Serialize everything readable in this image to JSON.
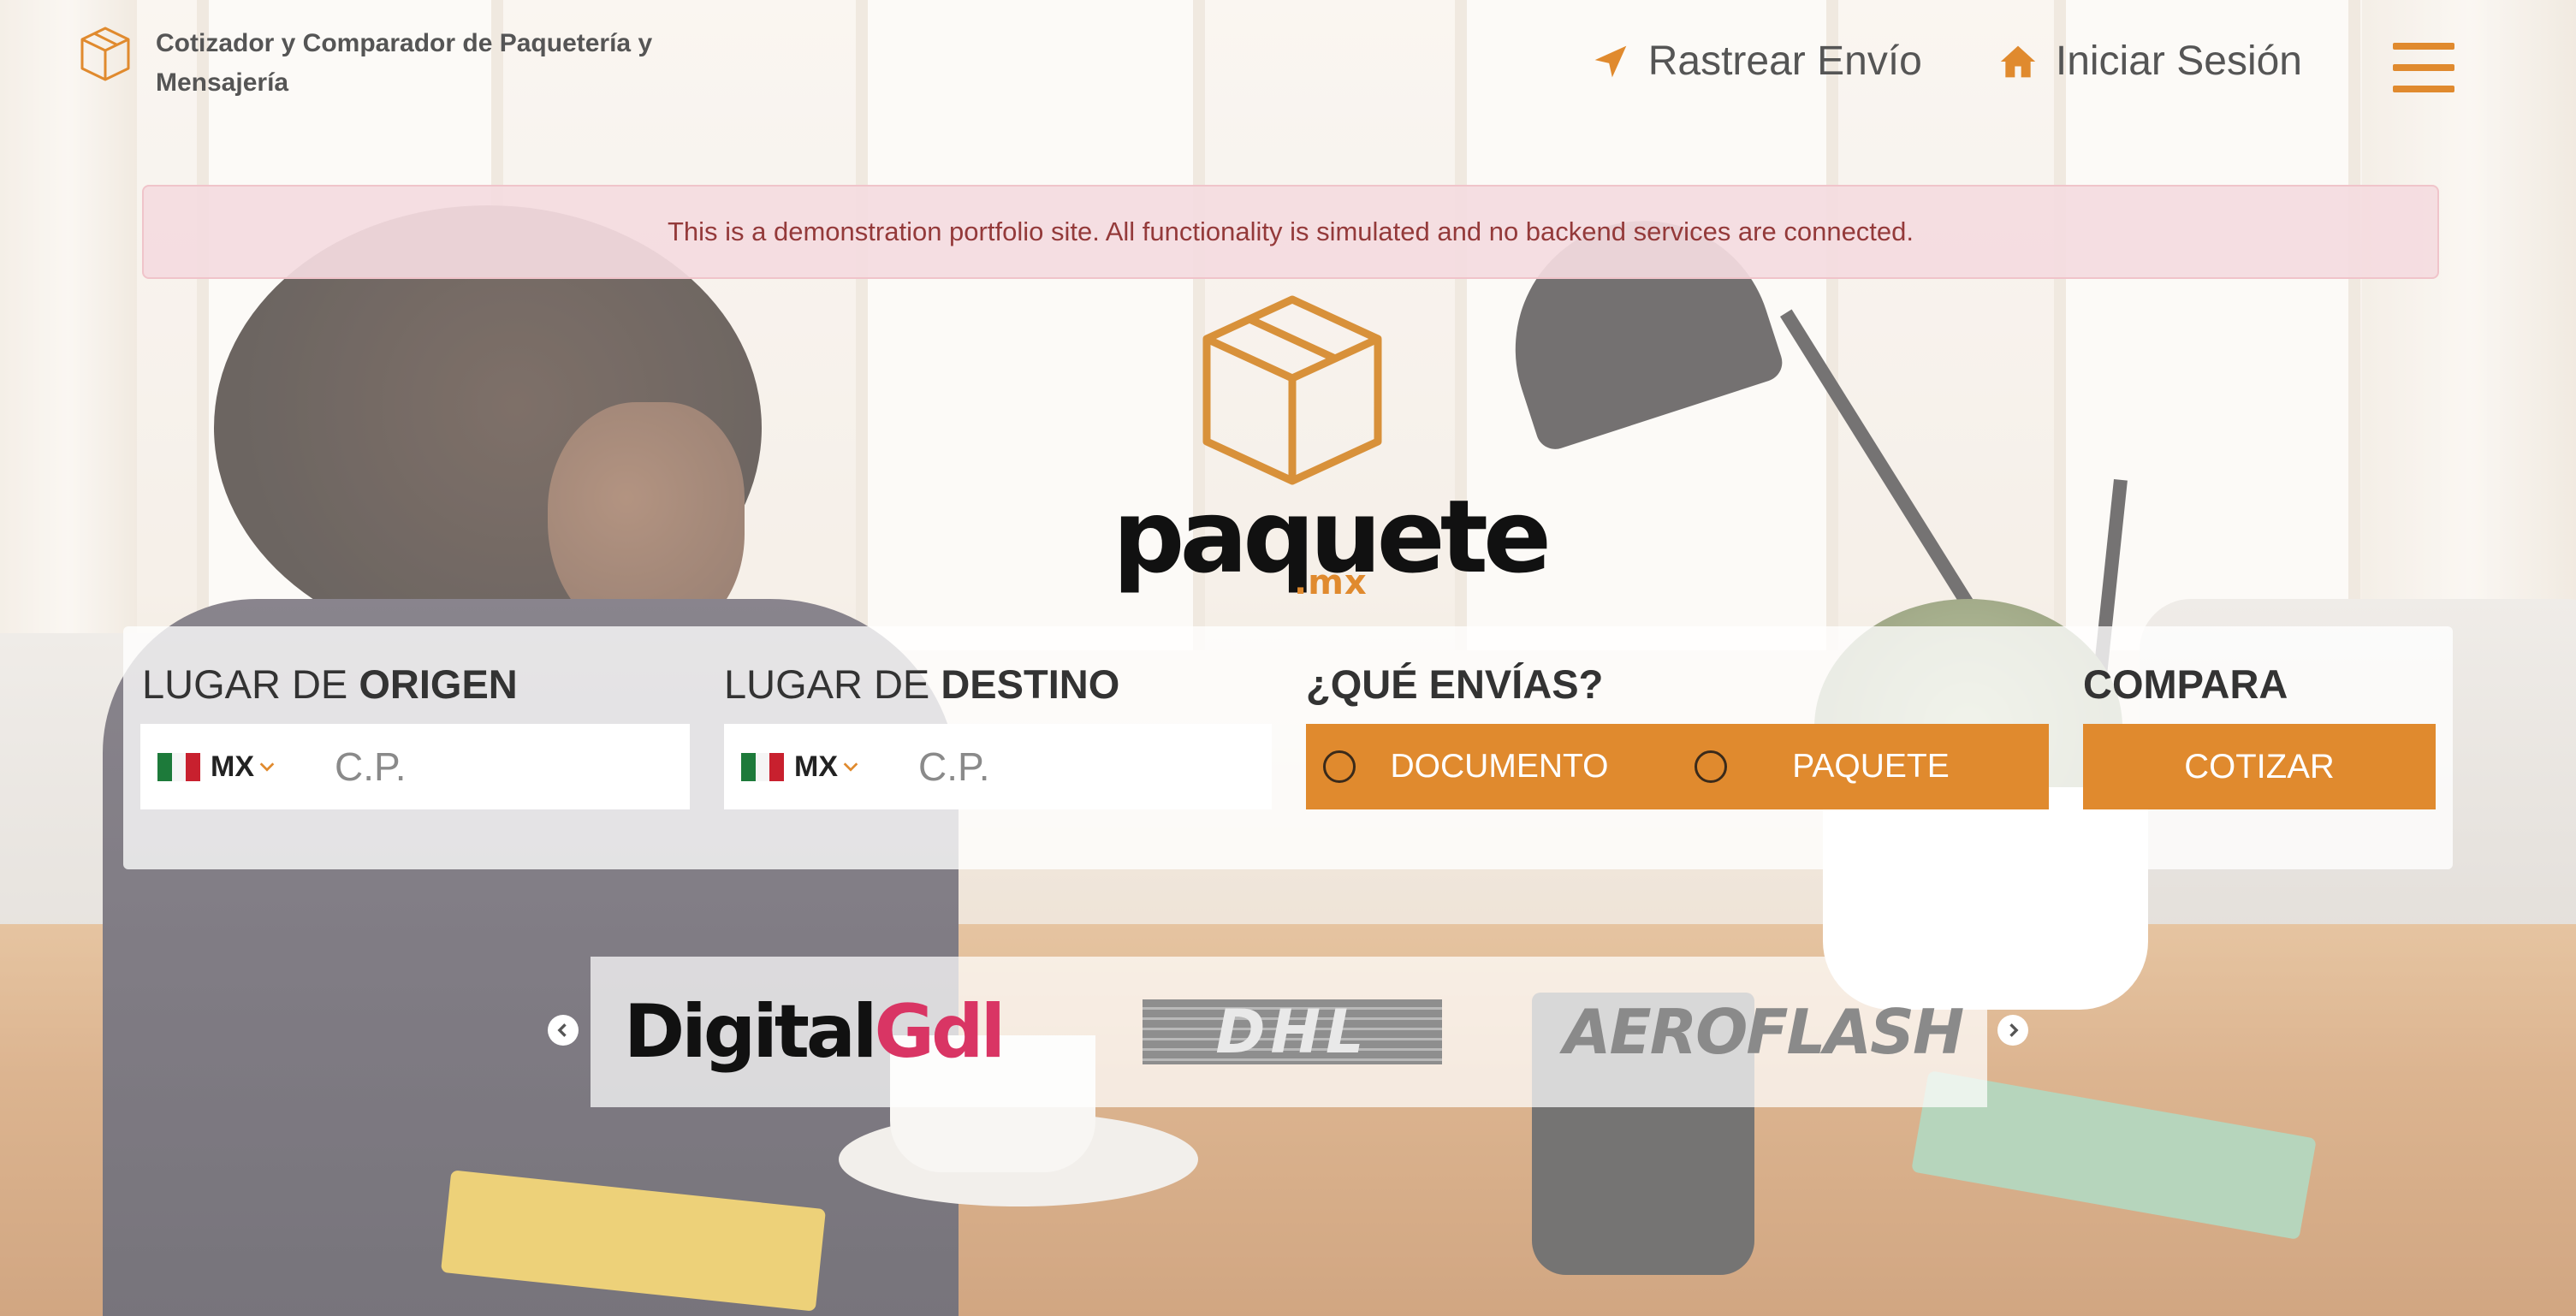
{
  "header": {
    "brand_text": "Cotizador y Comparador de Paquetería y Mensajería",
    "nav": {
      "track_label": "Rastrear Envío",
      "login_label": "Iniciar Sesión"
    }
  },
  "alert": {
    "message": "This is a demonstration portfolio site. All functionality is simulated and no backend services are connected."
  },
  "logo": {
    "word": "paquete",
    "tld": ".mx"
  },
  "form": {
    "origin": {
      "title_prefix": "LUGAR DE ",
      "title_bold": "ORIGEN",
      "country": "MX",
      "placeholder": "C.P."
    },
    "destination": {
      "title_prefix": "LUGAR DE ",
      "title_bold": "DESTINO",
      "country": "MX",
      "placeholder": "C.P."
    },
    "shipment": {
      "title": "¿QUÉ ENVÍAS?",
      "options": [
        "DOCUMENTO",
        "PAQUETE"
      ]
    },
    "compare": {
      "title": "COMPARA",
      "button_label": "COTIZAR"
    }
  },
  "carriers": {
    "items": [
      {
        "name_part1": "Digital",
        "name_part2": "Gdl"
      },
      {
        "name": "DHL"
      },
      {
        "name": "AEROFLASH"
      }
    ]
  },
  "colors": {
    "accent": "#e08a2e",
    "alert_text": "#943a3a",
    "alert_bg": "#f4dbdf"
  },
  "icons": [
    "cube-logo-icon",
    "location-arrow-icon",
    "home-icon",
    "hamburger-menu-icon",
    "mexico-flag-icon",
    "chevron-down-icon",
    "chevron-left-icon",
    "chevron-right-icon"
  ]
}
